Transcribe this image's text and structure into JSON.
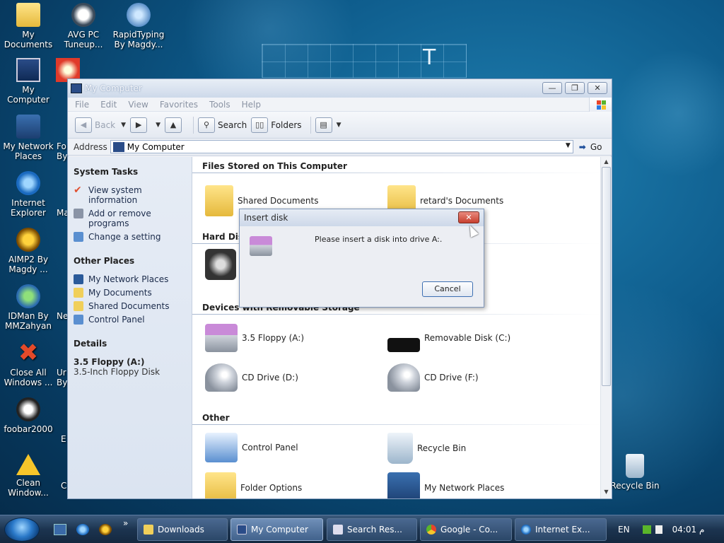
{
  "desktop": {
    "wallpaper_letter": "T",
    "icons": [
      {
        "label": "My Documents"
      },
      {
        "label": "AVG PC Tuneup..."
      },
      {
        "label": "RapidTyping By Magdy..."
      },
      {
        "label": "My Computer"
      },
      {
        "label": "My Network Places"
      },
      {
        "label": "Internet Explorer"
      },
      {
        "label": "AIMP2 By Magdy ..."
      },
      {
        "label": "IDMan By MMZahyan"
      },
      {
        "label": "Close All Windows ..."
      },
      {
        "label": "foobar2000"
      },
      {
        "label": "Clean Window..."
      },
      {
        "label": "Recycle Bin"
      }
    ],
    "partial_labels": [
      "Fo",
      "By",
      "Ma",
      "Ne",
      "Ur",
      "By",
      "E",
      "C"
    ]
  },
  "window": {
    "title": "My Computer",
    "buttons": {
      "minimize": "—",
      "restore": "❐",
      "close": "✕"
    },
    "menu": [
      "File",
      "Edit",
      "View",
      "Favorites",
      "Tools",
      "Help"
    ],
    "toolbar": {
      "back": "Back",
      "search": "Search",
      "folders": "Folders"
    },
    "address": {
      "label": "Address",
      "value": "My Computer",
      "go": "Go"
    }
  },
  "leftpane": {
    "system_tasks": {
      "title": "System Tasks",
      "items": [
        "View system information",
        "Add or remove programs",
        "Change a setting"
      ]
    },
    "other_places": {
      "title": "Other Places",
      "items": [
        "My Network Places",
        "My Documents",
        "Shared Documents",
        "Control Panel"
      ]
    },
    "details": {
      "title": "Details",
      "name": "3.5 Floppy (A:)",
      "desc": "3.5-Inch Floppy Disk"
    }
  },
  "content": {
    "groups": {
      "files": "Files Stored on This Computer",
      "hard": "Hard Disk",
      "removable": "Devices with Removable Storage",
      "other": "Other"
    },
    "files": [
      "Shared Documents",
      "retard's Documents"
    ],
    "removable": [
      "3.5 Floppy (A:)",
      "Removable Disk (C:)",
      "CD Drive (D:)",
      "CD Drive (F:)"
    ],
    "other": [
      "Control Panel",
      "Recycle Bin",
      "Folder Options",
      "My Network Places"
    ]
  },
  "dialog": {
    "title": "Insert disk",
    "close": "✕",
    "message": "Please insert a disk into drive A:.",
    "cancel": "Cancel"
  },
  "taskbar": {
    "chevron": "»",
    "tasks": [
      "Downloads",
      "My Computer",
      "Search Res...",
      "Google - Co...",
      "Internet Ex..."
    ],
    "lang": "EN",
    "clock": "04:01 م"
  }
}
